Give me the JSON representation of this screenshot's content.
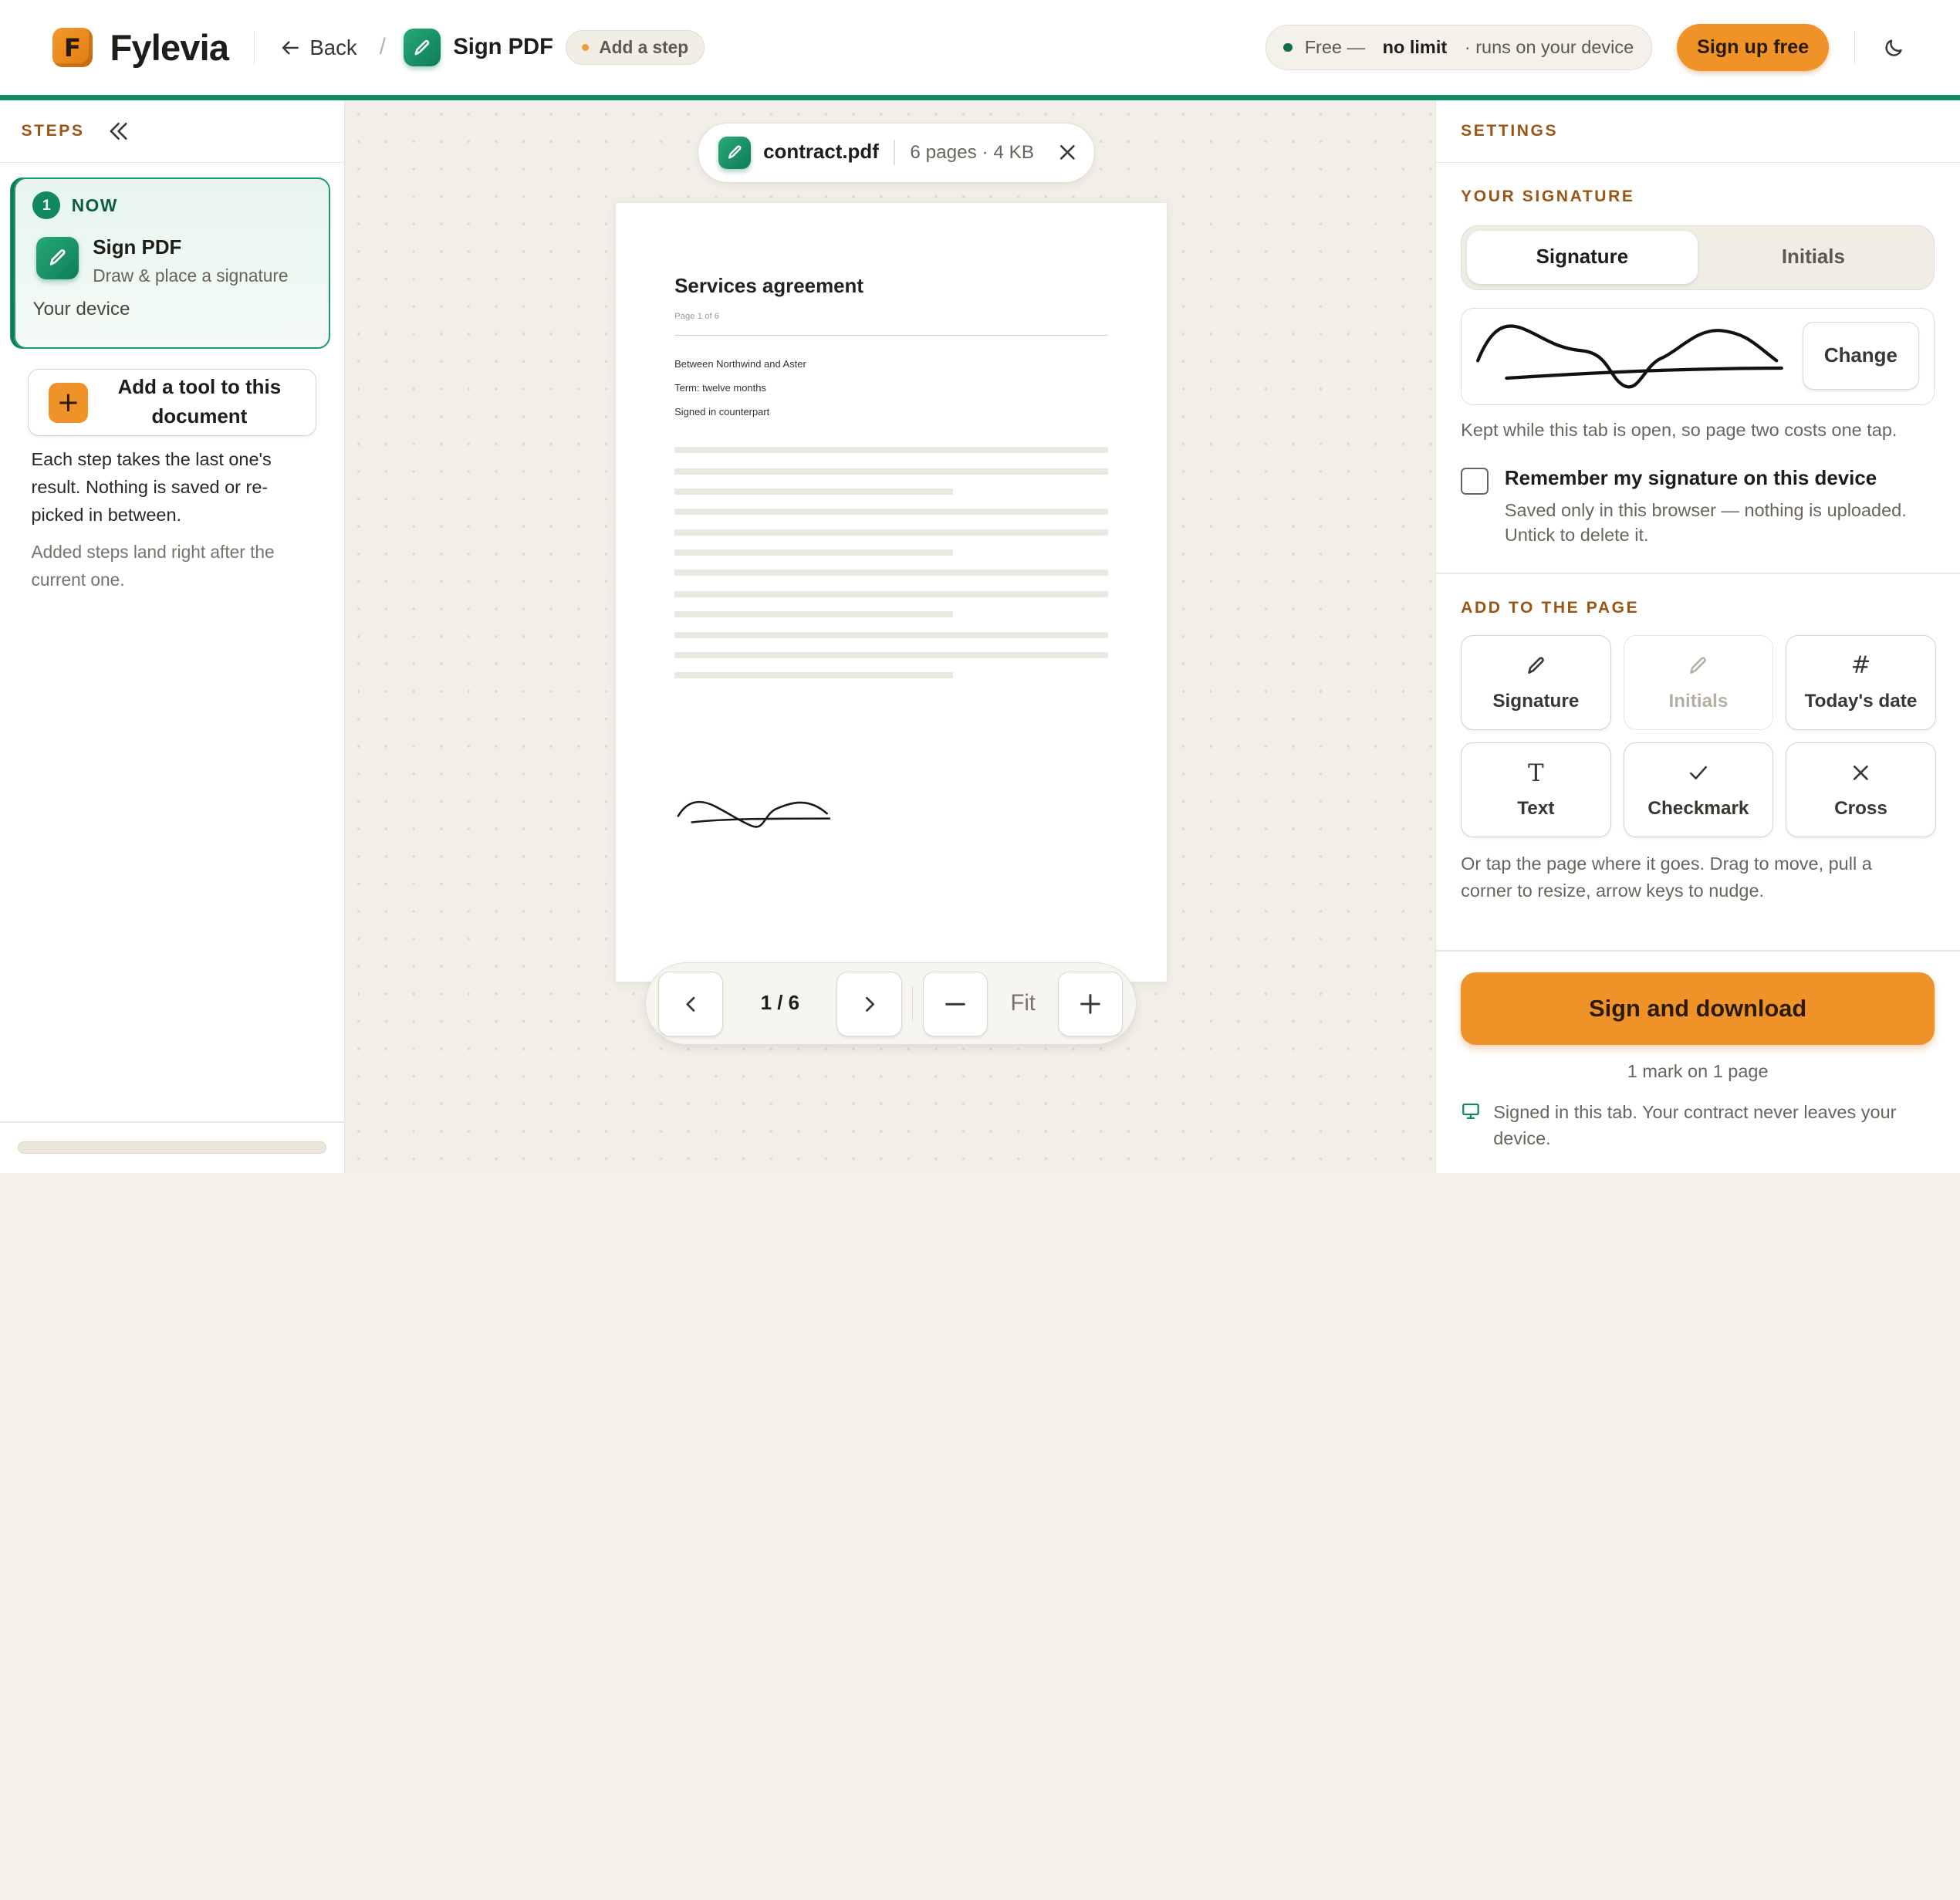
{
  "header": {
    "logo_letter": "F",
    "brand": "Fylevia",
    "back_label": "Back",
    "breadcrumb_sep": "/",
    "tool_name": "Sign PDF",
    "add_step_label": "Add a step",
    "free_prefix": "Free —",
    "free_bold": "no limit",
    "free_suffix": "· runs on your device",
    "signup_label": "Sign up free",
    "theme_icon": "moon-icon"
  },
  "steps": {
    "heading": "STEPS",
    "collapse_icon": "double-chevron-left-icon",
    "current": {
      "number": "1",
      "status": "NOW",
      "title": "Sign PDF",
      "subtitle": "Draw & place a signature",
      "location": "Your device"
    },
    "add_tool_label": "Add a tool to this document",
    "note": "Each step takes the last one's result. Nothing is saved or re-picked in between.",
    "note_secondary": "Added steps land right after the current one."
  },
  "document": {
    "file_name": "contract.pdf",
    "file_meta": "6 pages · 4 KB",
    "close_icon": "close-icon",
    "page": {
      "title": "Services agreement",
      "page_label": "Page 1 of 6",
      "lines": [
        "Between Northwind and Aster",
        "Term: twelve months",
        "Signed in counterpart"
      ]
    },
    "pager": {
      "count": "1 / 6",
      "fit_label": "Fit"
    }
  },
  "settings": {
    "heading": "SETTINGS",
    "your_signature_heading": "YOUR SIGNATURE",
    "tabs": [
      "Signature",
      "Initials"
    ],
    "active_tab": "Signature",
    "change_label": "Change",
    "kept_note": "Kept while this tab is open, so page two costs one tap.",
    "remember_label": "Remember my signature on this device",
    "remember_checked": false,
    "remember_sub": "Saved only in this browser — nothing is uploaded. Untick to delete it.",
    "add_heading": "ADD TO THE PAGE",
    "tiles": [
      {
        "label": "Signature",
        "icon": "pen-icon",
        "enabled": true
      },
      {
        "label": "Initials",
        "icon": "pen-icon",
        "enabled": false
      },
      {
        "label": "Today's date",
        "icon": "hash-icon",
        "enabled": true
      },
      {
        "label": "Text",
        "icon": "text-icon",
        "enabled": true
      },
      {
        "label": "Checkmark",
        "icon": "check-icon",
        "enabled": true
      },
      {
        "label": "Cross",
        "icon": "cross-icon",
        "enabled": true
      }
    ],
    "tap_note": "Or tap the page where it goes. Drag to move, pull a corner to resize, arrow keys to nudge.",
    "primary_label": "Sign and download",
    "marks_count": "1 mark on 1 page",
    "footer_note": "Signed in this tab. Your contract never leaves your device."
  },
  "colors": {
    "accent_green": "#11885f",
    "accent_orange": "#ef9329",
    "label_brown": "#9a5414"
  }
}
